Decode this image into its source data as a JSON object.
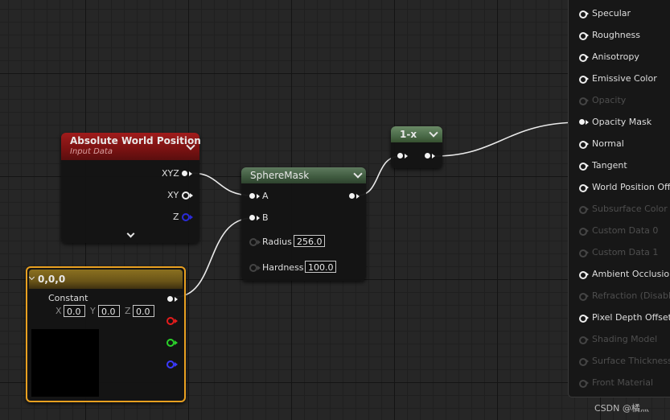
{
  "nodes": {
    "absolute_world_position": {
      "title": "Absolute World Position",
      "subtitle": "Input Data",
      "outputs": [
        "XYZ",
        "XY",
        "Z"
      ]
    },
    "sphere_mask": {
      "title": "SphereMask",
      "inputs": [
        "A",
        "B"
      ],
      "radius_label": "Radius",
      "radius_value": "256.0",
      "hardness_label": "Hardness",
      "hardness_value": "100.0"
    },
    "one_minus": {
      "title": "1-x"
    },
    "constant": {
      "title": "0,0,0",
      "label": "Constant",
      "x_label": "X",
      "x_value": "0.0",
      "y_label": "Y",
      "y_value": "0.0",
      "z_label": "Z",
      "z_value": "0.0",
      "preview_color": "#000000"
    }
  },
  "material_output": {
    "pins": [
      {
        "label": "Specular",
        "enabled": true
      },
      {
        "label": "Roughness",
        "enabled": true
      },
      {
        "label": "Anisotropy",
        "enabled": true
      },
      {
        "label": "Emissive Color",
        "enabled": true
      },
      {
        "label": "Opacity",
        "enabled": false
      },
      {
        "label": "Opacity Mask",
        "enabled": true,
        "connected": true
      },
      {
        "label": "Normal",
        "enabled": true
      },
      {
        "label": "Tangent",
        "enabled": true
      },
      {
        "label": "World Position Offset",
        "enabled": true
      },
      {
        "label": "Subsurface Color",
        "enabled": false
      },
      {
        "label": "Custom Data 0",
        "enabled": false
      },
      {
        "label": "Custom Data 1",
        "enabled": false
      },
      {
        "label": "Ambient Occlusion",
        "enabled": true
      },
      {
        "label": "Refraction (Disabled)",
        "enabled": false
      },
      {
        "label": "Pixel Depth Offset",
        "enabled": true
      },
      {
        "label": "Shading Model",
        "enabled": false
      },
      {
        "label": "Surface Thickness",
        "enabled": false
      },
      {
        "label": "Front Material",
        "enabled": false
      }
    ]
  },
  "watermark": "CSDN @橘灬",
  "colors": {
    "awp_header": "#8a1414",
    "sphere_mask_header": "#3f5a3f",
    "one_minus_header": "#4a6a48",
    "constant_header": "#6a5418",
    "selection_outline": "#e8a020",
    "wire": "#eaeaea"
  }
}
